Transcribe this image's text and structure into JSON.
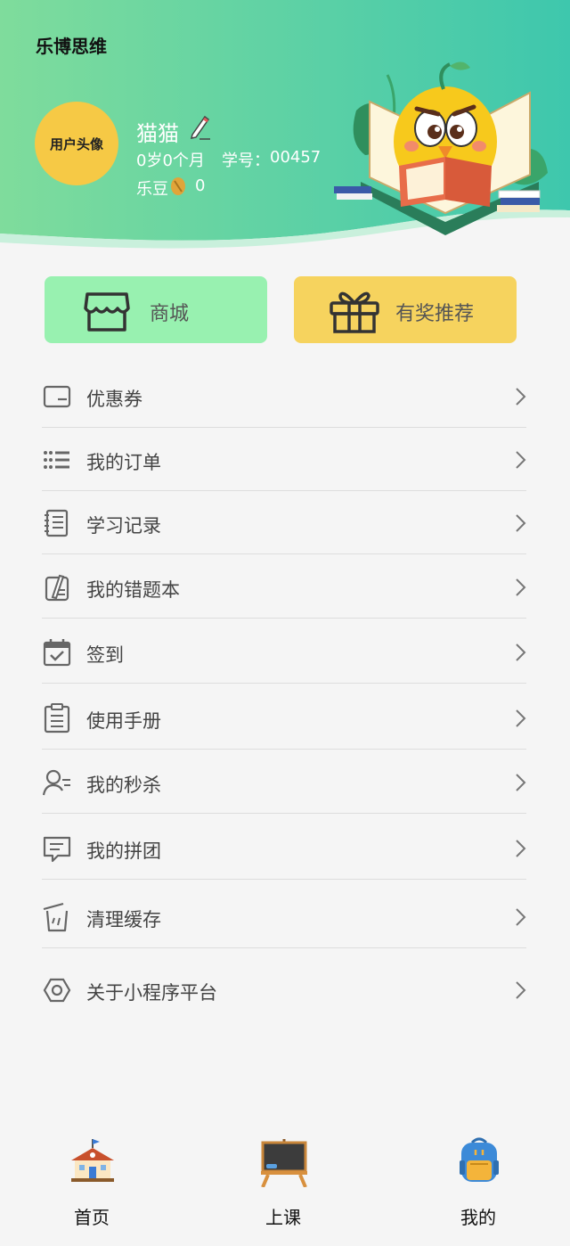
{
  "app": {
    "title": "乐博思维"
  },
  "profile": {
    "avatar_label": "用户头像",
    "name": "猫猫",
    "age": "0岁0个月",
    "student_id_label": "学号：",
    "student_id": "00457",
    "beans_label": "乐豆",
    "beans_value": "0"
  },
  "quick_actions": {
    "shop_label": "商城",
    "reward_label": "有奖推荐"
  },
  "menu": {
    "items": [
      {
        "label": "优惠券",
        "icon": "coupon-icon"
      },
      {
        "label": "我的订单",
        "icon": "list-icon"
      },
      {
        "label": "学习记录",
        "icon": "notebook-icon"
      },
      {
        "label": "我的错题本",
        "icon": "pen-book-icon"
      },
      {
        "label": "签到",
        "icon": "calendar-check-icon"
      },
      {
        "label": "使用手册",
        "icon": "clipboard-icon"
      },
      {
        "label": "我的秒杀",
        "icon": "user-icon"
      },
      {
        "label": "我的拼团",
        "icon": "chat-icon"
      },
      {
        "label": "清理缓存",
        "icon": "trash-icon"
      },
      {
        "label": "关于小程序平台",
        "icon": "hexagon-icon"
      }
    ]
  },
  "tabbar": {
    "home_label": "首页",
    "class_label": "上课",
    "mine_label": "我的"
  },
  "colors": {
    "header_green": "#5fd09a",
    "shop_green": "#98f1b0",
    "reward_yellow": "#f6d35e",
    "avatar_yellow": "#f6c945"
  }
}
